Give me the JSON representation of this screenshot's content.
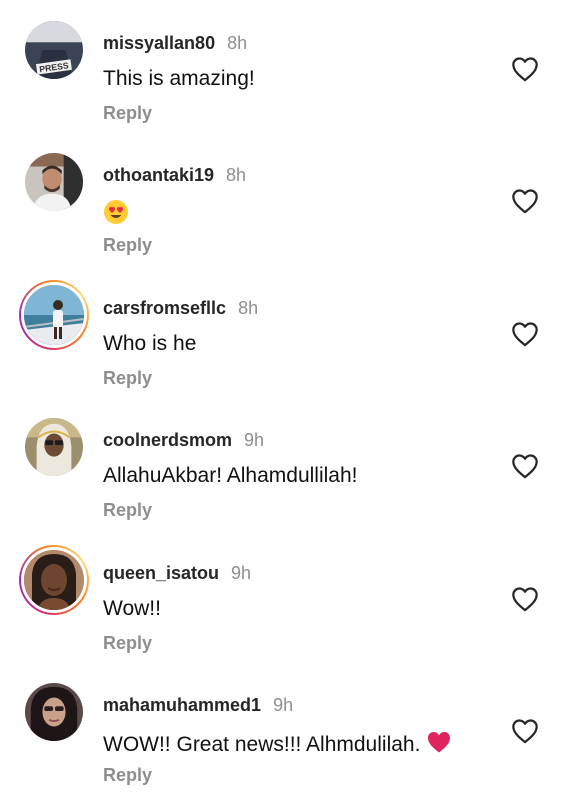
{
  "comments": [
    {
      "username": "missyallan80",
      "time": "8h",
      "text": "This is amazing!",
      "reply": "Reply"
    },
    {
      "username": "othoantaki19",
      "time": "8h",
      "text": "",
      "emoji": "heart-eyes-emoji",
      "reply": "Reply"
    },
    {
      "username": "carsfromsefllc",
      "time": "8h",
      "text": "Who is he",
      "reply": "Reply"
    },
    {
      "username": "coolnerdsmom",
      "time": "9h",
      "text": "AllahuAkbar! Alhamdullilah!",
      "reply": "Reply"
    },
    {
      "username": "queen_isatou",
      "time": "9h",
      "text": "Wow!!",
      "reply": "Reply"
    },
    {
      "username": "mahamuhammed1",
      "time": "9h",
      "text": "WOW!! Great news!!! Alhmdulilah. ",
      "emoji": "red-heart-emoji",
      "reply": "Reply"
    }
  ],
  "avatar_press_text": "PRESS",
  "colors": {
    "muted": "#8e8e8e",
    "text": "#262626",
    "heart_red": "#e0245e"
  }
}
